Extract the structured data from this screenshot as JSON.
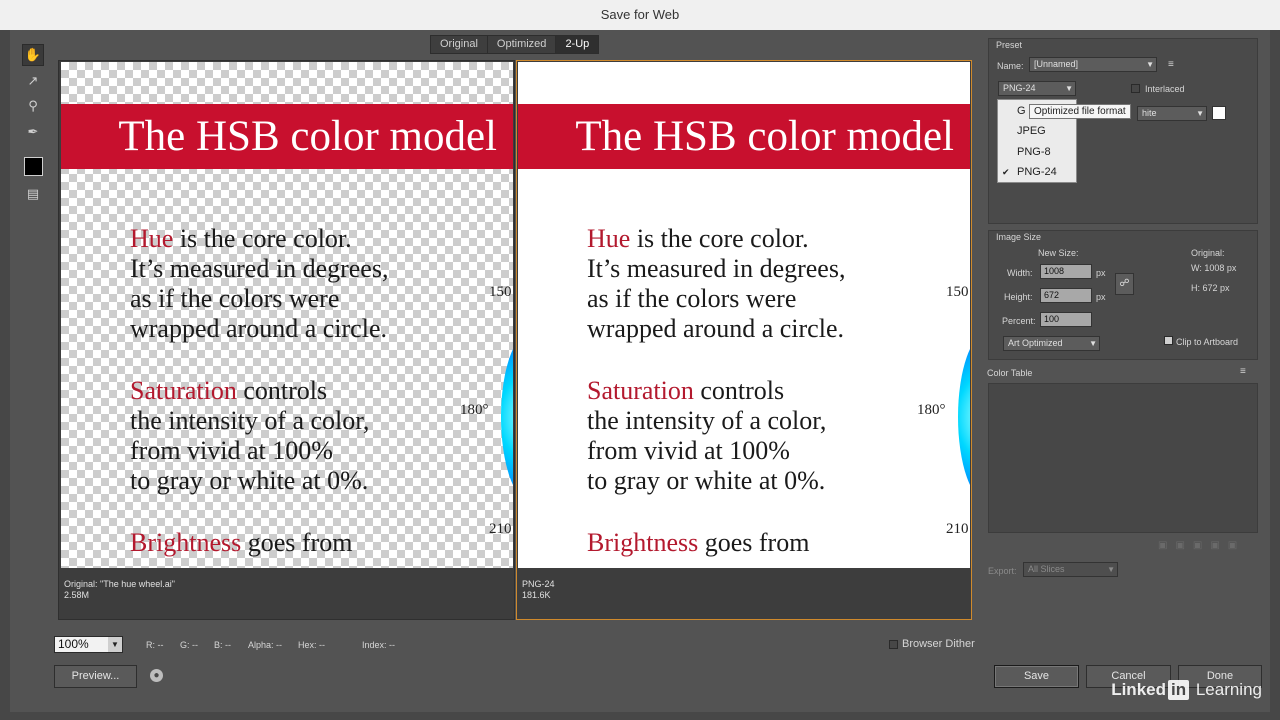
{
  "window": {
    "title": "Save for Web"
  },
  "tools": [
    {
      "name": "hand-tool",
      "glyph": "✋"
    },
    {
      "name": "slice-select-tool",
      "glyph": "↗"
    },
    {
      "name": "zoom-tool",
      "glyph": "⚲"
    },
    {
      "name": "eyedropper-tool",
      "glyph": "✒"
    }
  ],
  "tabs": [
    "Original",
    "Optimized",
    "2-Up"
  ],
  "active_tab": "2-Up",
  "artwork": {
    "title": "The HSB color model",
    "paragraphs": [
      {
        "keyword": "Hue",
        "first_rest": " is the core color.",
        "lines": [
          "It’s measured in degrees,",
          "as if the colors were",
          "wrapped around a circle."
        ]
      },
      {
        "keyword": "Saturation",
        "first_rest": " controls",
        "lines": [
          "the intensity of a color,",
          "from vivid at 100%",
          "to gray or white at 0%."
        ]
      },
      {
        "keyword": "Brightness",
        "first_rest": " goes from",
        "lines": []
      }
    ],
    "degree_labels": [
      "150",
      "180°",
      "210"
    ]
  },
  "left_pane": {
    "info_line1": "Original: \"The hue wheel.ai\"",
    "info_line2": "2.58M"
  },
  "right_pane": {
    "info_line1": "PNG-24",
    "info_line2": "181.6K"
  },
  "bottom": {
    "zoom": "100%",
    "readouts": [
      "R: --",
      "G: --",
      "B: --",
      "Alpha: --",
      "Hex: --",
      "Index: --"
    ],
    "browser_dither": "Browser Dither",
    "preview": "Preview...",
    "save": "Save",
    "cancel": "Cancel",
    "done": "Done"
  },
  "preset": {
    "section": "Preset",
    "name_label": "Name:",
    "name_value": "[Unnamed]",
    "format": "PNG-24",
    "interlaced": "Interlaced",
    "matte_value": "hite",
    "format_options": [
      "GIF",
      "JPEG",
      "PNG-8",
      "PNG-24"
    ],
    "format_option_first_visible": "G",
    "selected_format": "PNG-24",
    "tooltip": "Optimized file format"
  },
  "image_size": {
    "section": "Image Size",
    "new_size": "New Size:",
    "width_label": "Width:",
    "width_value": "1008",
    "height_label": "Height:",
    "height_value": "672",
    "percent_label": "Percent:",
    "percent_value": "100",
    "unit": "px",
    "original_label": "Original:",
    "original_w": "W:  1008 px",
    "original_h": "H:   672 px",
    "clip": "Clip to Artboard",
    "quality": "Art Optimized"
  },
  "color_table": {
    "section": "Color Table"
  },
  "export": {
    "label": "Export:",
    "value": "All Slices"
  },
  "watermark": {
    "part1": "Linked",
    "part2": "in",
    "part3": " Learning"
  }
}
